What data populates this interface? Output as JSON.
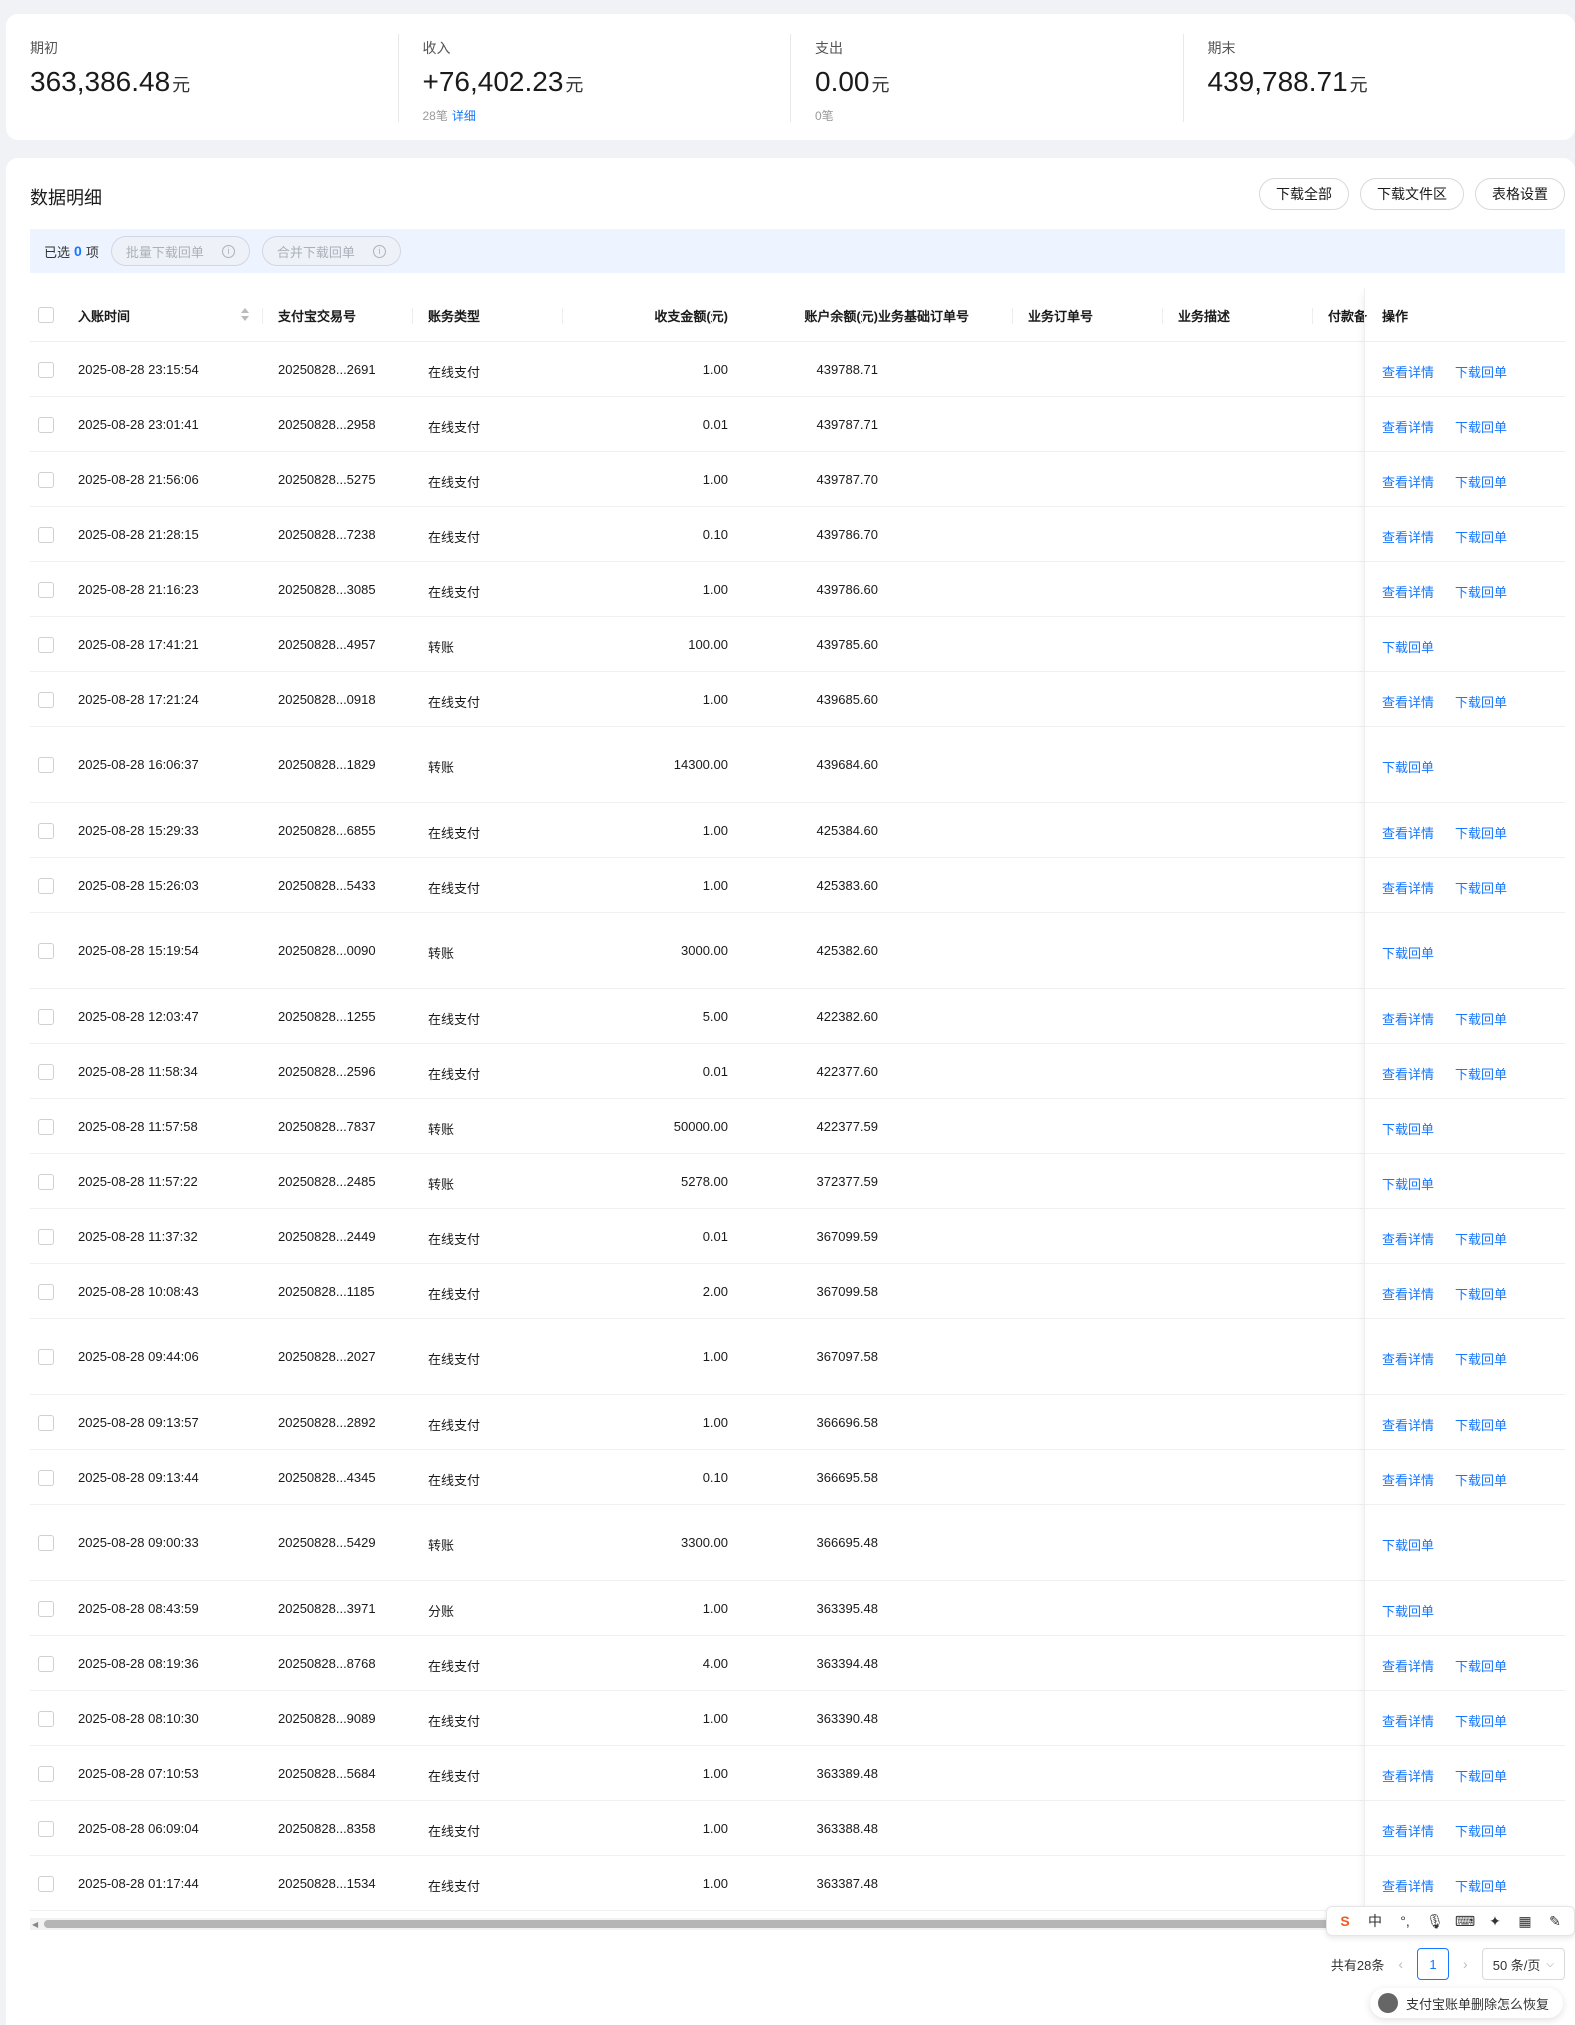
{
  "summary": {
    "opening": {
      "label": "期初",
      "value": "363,386.48",
      "unit": "元"
    },
    "income": {
      "label": "收入",
      "value": "+76,402.23",
      "unit": "元",
      "count": "28笔",
      "detail_link": "详细"
    },
    "expense": {
      "label": "支出",
      "value": "0.00",
      "unit": "元",
      "count": "0笔"
    },
    "closing": {
      "label": "期末",
      "value": "439,788.71",
      "unit": "元"
    }
  },
  "panel": {
    "title": "数据明细",
    "buttons": {
      "download_all": "下载全部",
      "download_folder": "下载文件区",
      "table_settings": "表格设置"
    }
  },
  "selection": {
    "prefix": "已选",
    "count": "0",
    "suffix": "项",
    "batch_download": "批量下载回单",
    "merge_download": "合并下载回单"
  },
  "columns": [
    "入账时间",
    "支付宝交易号",
    "账务类型",
    "收支金额(元)",
    "账户余额(元)",
    "业务基础订单号",
    "业务订单号",
    "业务描述",
    "付款备",
    "操作"
  ],
  "actions": {
    "view_detail": "查看详情",
    "download_receipt": "下载回单"
  },
  "rows": [
    {
      "time": "2025-08-28 23:15:54",
      "txn": "20250828...2691",
      "type": "在线支付",
      "amount": "1.00",
      "balance": "439788.71",
      "detail": true
    },
    {
      "time": "2025-08-28 23:01:41",
      "txn": "20250828...2958",
      "type": "在线支付",
      "amount": "0.01",
      "balance": "439787.71",
      "detail": true
    },
    {
      "time": "2025-08-28 21:56:06",
      "txn": "20250828...5275",
      "type": "在线支付",
      "amount": "1.00",
      "balance": "439787.70",
      "detail": true
    },
    {
      "time": "2025-08-28 21:28:15",
      "txn": "20250828...7238",
      "type": "在线支付",
      "amount": "0.10",
      "balance": "439786.70",
      "detail": true
    },
    {
      "time": "2025-08-28 21:16:23",
      "txn": "20250828...3085",
      "type": "在线支付",
      "amount": "1.00",
      "balance": "439786.60",
      "detail": true
    },
    {
      "time": "2025-08-28 17:41:21",
      "txn": "20250828...4957",
      "type": "转账",
      "amount": "100.00",
      "balance": "439785.60",
      "detail": false
    },
    {
      "time": "2025-08-28 17:21:24",
      "txn": "20250828...0918",
      "type": "在线支付",
      "amount": "1.00",
      "balance": "439685.60",
      "detail": true
    },
    {
      "time": "2025-08-28 16:06:37",
      "txn": "20250828...1829",
      "type": "转账",
      "amount": "14300.00",
      "balance": "439684.60",
      "detail": false
    },
    {
      "time": "2025-08-28 15:29:33",
      "txn": "20250828...6855",
      "type": "在线支付",
      "amount": "1.00",
      "balance": "425384.60",
      "detail": true
    },
    {
      "time": "2025-08-28 15:26:03",
      "txn": "20250828...5433",
      "type": "在线支付",
      "amount": "1.00",
      "balance": "425383.60",
      "detail": true
    },
    {
      "time": "2025-08-28 15:19:54",
      "txn": "20250828...0090",
      "type": "转账",
      "amount": "3000.00",
      "balance": "425382.60",
      "detail": false
    },
    {
      "time": "2025-08-28 12:03:47",
      "txn": "20250828...1255",
      "type": "在线支付",
      "amount": "5.00",
      "balance": "422382.60",
      "detail": true
    },
    {
      "time": "2025-08-28 11:58:34",
      "txn": "20250828...2596",
      "type": "在线支付",
      "amount": "0.01",
      "balance": "422377.60",
      "detail": true
    },
    {
      "time": "2025-08-28 11:57:58",
      "txn": "20250828...7837",
      "type": "转账",
      "amount": "50000.00",
      "balance": "422377.59",
      "detail": false
    },
    {
      "time": "2025-08-28 11:57:22",
      "txn": "20250828...2485",
      "type": "转账",
      "amount": "5278.00",
      "balance": "372377.59",
      "detail": false
    },
    {
      "time": "2025-08-28 11:37:32",
      "txn": "20250828...2449",
      "type": "在线支付",
      "amount": "0.01",
      "balance": "367099.59",
      "detail": true
    },
    {
      "time": "2025-08-28 10:08:43",
      "txn": "20250828...1185",
      "type": "在线支付",
      "amount": "2.00",
      "balance": "367099.58",
      "detail": true
    },
    {
      "time": "2025-08-28 09:44:06",
      "txn": "20250828...2027",
      "type": "在线支付",
      "amount": "1.00",
      "balance": "367097.58",
      "detail": true
    },
    {
      "time": "2025-08-28 09:13:57",
      "txn": "20250828...2892",
      "type": "在线支付",
      "amount": "1.00",
      "balance": "366696.58",
      "detail": true
    },
    {
      "time": "2025-08-28 09:13:44",
      "txn": "20250828...4345",
      "type": "在线支付",
      "amount": "0.10",
      "balance": "366695.58",
      "detail": true
    },
    {
      "time": "2025-08-28 09:00:33",
      "txn": "20250828...5429",
      "type": "转账",
      "amount": "3300.00",
      "balance": "366695.48",
      "detail": false
    },
    {
      "time": "2025-08-28 08:43:59",
      "txn": "20250828...3971",
      "type": "分账",
      "amount": "1.00",
      "balance": "363395.48",
      "detail": false
    },
    {
      "time": "2025-08-28 08:19:36",
      "txn": "20250828...8768",
      "type": "在线支付",
      "amount": "4.00",
      "balance": "363394.48",
      "detail": true
    },
    {
      "time": "2025-08-28 08:10:30",
      "txn": "20250828...9089",
      "type": "在线支付",
      "amount": "1.00",
      "balance": "363390.48",
      "detail": true
    },
    {
      "time": "2025-08-28 07:10:53",
      "txn": "20250828...5684",
      "type": "在线支付",
      "amount": "1.00",
      "balance": "363389.48",
      "detail": true
    },
    {
      "time": "2025-08-28 06:09:04",
      "txn": "20250828...8358",
      "type": "在线支付",
      "amount": "1.00",
      "balance": "363388.48",
      "detail": true
    },
    {
      "time": "2025-08-28 01:17:44",
      "txn": "20250828...1534",
      "type": "在线支付",
      "amount": "1.00",
      "balance": "363387.48",
      "detail": true
    }
  ],
  "pagination": {
    "total": "共有28条",
    "page": "1",
    "page_size": "50 条/页"
  },
  "ime": {
    "items": [
      "S",
      "中",
      "°,",
      "🎙",
      "⌨",
      "✦",
      "▦",
      "✎"
    ]
  },
  "help": {
    "text": "支付宝账单删除怎么恢复"
  },
  "colors": {
    "accent": "#1677ff",
    "selbar_bg": "#eef4ff"
  },
  "icons": {
    "sort": "sort-icon",
    "info": "info-icon",
    "avatar": "avatar-icon"
  }
}
